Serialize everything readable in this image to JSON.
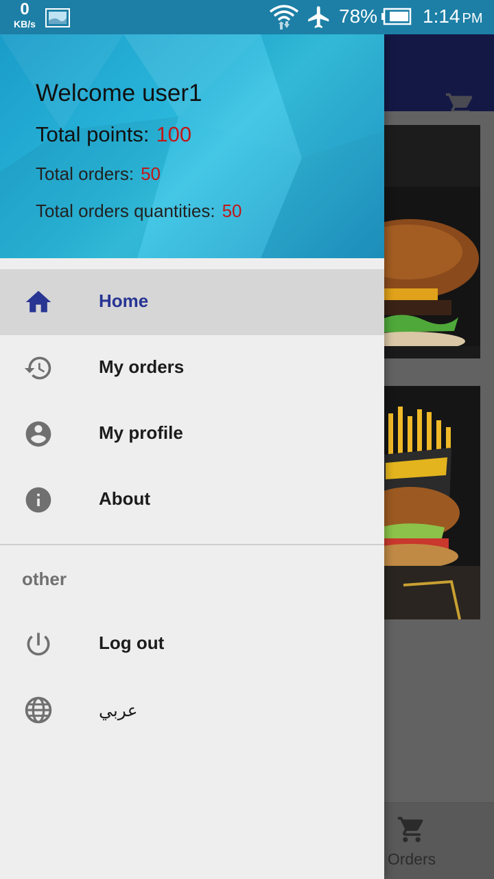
{
  "status_bar": {
    "net_speed_value": "0",
    "net_speed_unit": "KB/s",
    "battery_percent": "78%",
    "time": "1:14",
    "ampm": "PM",
    "icons": [
      "image-notification-icon",
      "wifi-icon",
      "airplane-icon",
      "battery-icon"
    ]
  },
  "drawer": {
    "header": {
      "welcome": "Welcome user1",
      "total_points_label": "Total points:",
      "total_points_value": "100",
      "total_orders_label": "Total orders:",
      "total_orders_value": "50",
      "total_qty_label": "Total orders quantities:",
      "total_qty_value": "50"
    },
    "menu": [
      {
        "label": "Home",
        "icon": "home-icon",
        "active": true
      },
      {
        "label": "My orders",
        "icon": "history-icon",
        "active": false
      },
      {
        "label": "My profile",
        "icon": "account-circle-icon",
        "active": false
      },
      {
        "label": "About",
        "icon": "info-icon",
        "active": false
      }
    ],
    "section_title": "other",
    "other_menu": [
      {
        "label": "Log out",
        "icon": "power-icon"
      },
      {
        "label": "عربي",
        "icon": "globe-icon"
      }
    ]
  },
  "background_app": {
    "bottom_nav_orders_label": "Orders",
    "icons": [
      "cart-icon"
    ]
  },
  "colors": {
    "header_gradient": "#2bb9dd",
    "status_bar": "#1d7fa6",
    "active_item": "#283593",
    "stat_value": "#c01818",
    "toolbar": "#141845"
  }
}
